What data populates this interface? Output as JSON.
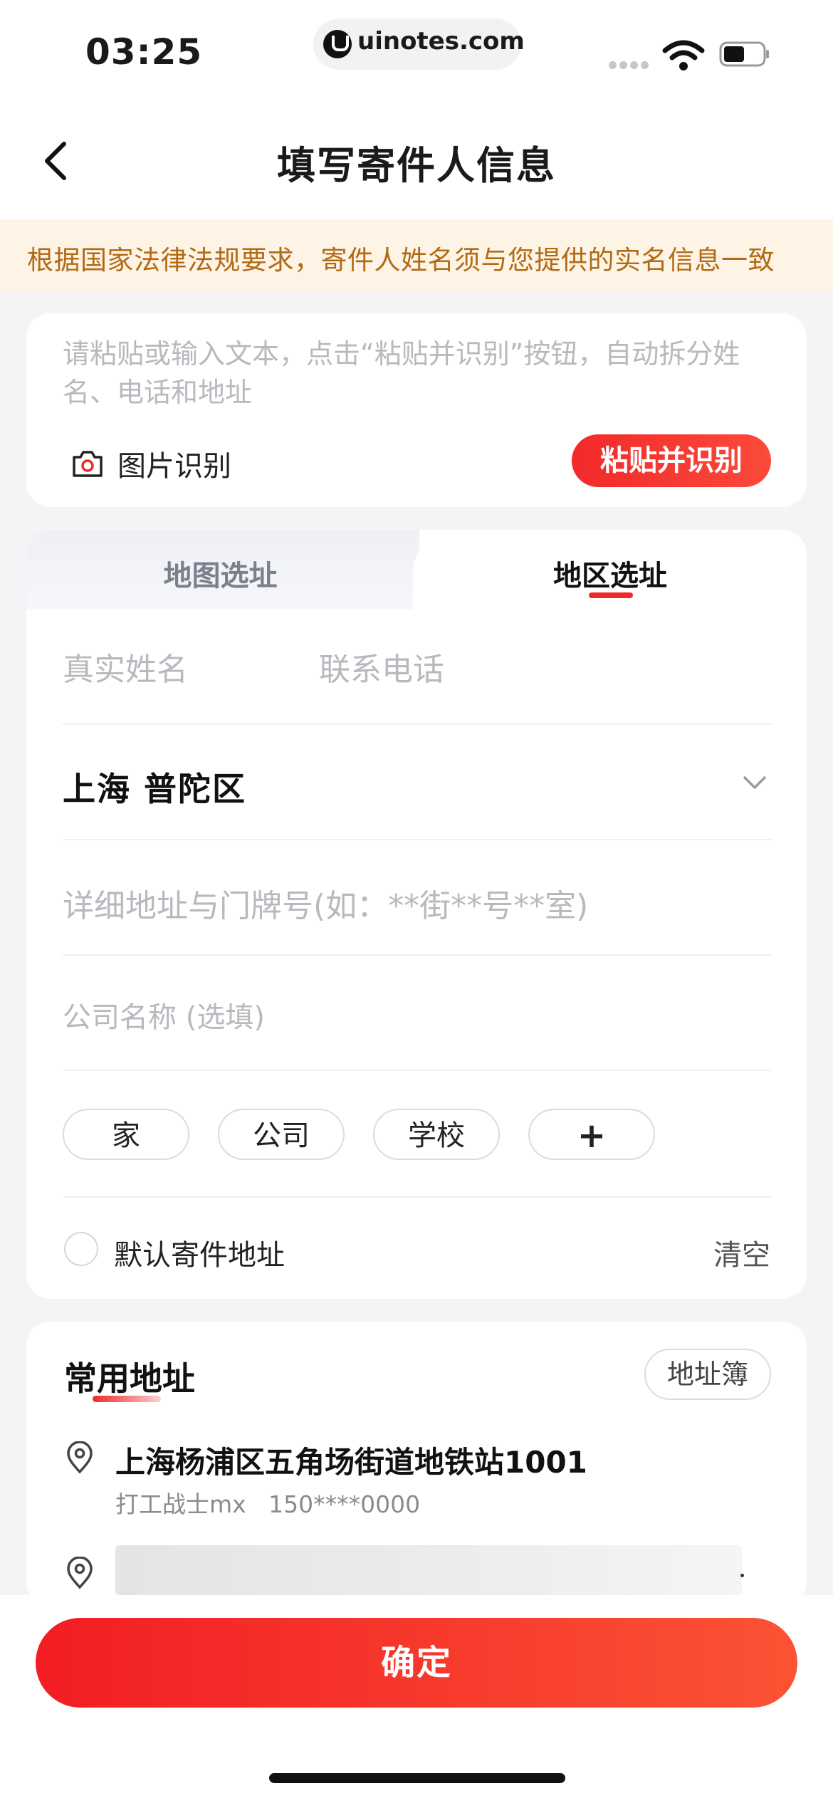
{
  "status_bar": {
    "time": "03:25",
    "url": "uinotes.com"
  },
  "header": {
    "back_icon": "chevron-left-icon",
    "title": "填写寄件人信息"
  },
  "notice": {
    "text": "根据国家法律法规要求，寄件人姓名须与您提供的实名信息一致",
    "color": "#b26a14"
  },
  "smart_input": {
    "placeholder": "请粘贴或输入文本，点击“粘贴并识别”按钮，自动拆分姓名、电话和地址",
    "image_recognize_label": "图片识别",
    "paste_button_label": "粘贴并识别"
  },
  "tabs": [
    {
      "label": "地图选址",
      "active": false
    },
    {
      "label": "地区选址",
      "active": true
    }
  ],
  "form": {
    "name_placeholder": "真实姓名",
    "phone_placeholder": "联系电话",
    "region_value": "上海  普陀区",
    "address_placeholder": "详细地址与门牌号(如：**街**号**室)",
    "company_placeholder": "公司名称 (选填)",
    "tags": [
      "家",
      "公司",
      "学校",
      "+"
    ],
    "default_label": "默认寄件地址",
    "clear_label": "清空"
  },
  "common_addresses": {
    "title": "常用地址",
    "book_button_label": "地址簿",
    "items": [
      {
        "address": "上海杨浦区五角场街道地铁站1001",
        "contact": "打工战士mx   150****0000"
      }
    ]
  },
  "confirm_label": "确定",
  "accent_color": "#f0282e"
}
